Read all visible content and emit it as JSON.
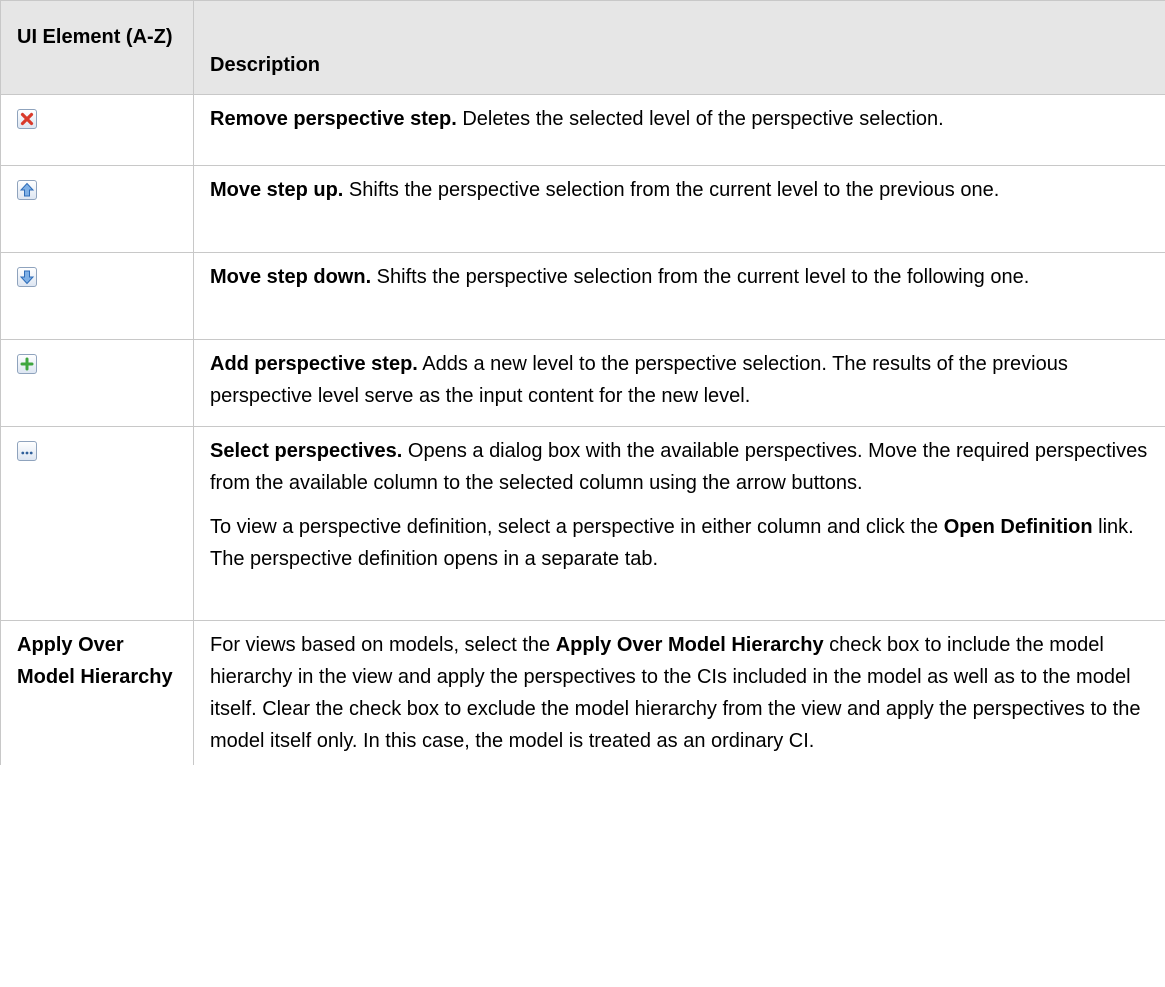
{
  "header": {
    "col1": "UI Element (A-Z)",
    "col2": "Description"
  },
  "rows": [
    {
      "icon": "remove-icon",
      "term": "Remove perspective step.",
      "text": " Deletes the selected level of the perspective selection."
    },
    {
      "icon": "move-up-icon",
      "term": "Move step up.",
      "text": " Shifts the perspective selection from the current level to the previous one."
    },
    {
      "icon": "move-down-icon",
      "term": "Move step down.",
      "text": " Shifts the perspective selection from the current level to the following one."
    },
    {
      "icon": "add-icon",
      "term": "Add perspective step.",
      "text": " Adds a new level to the perspective selection. The results of the previous perspective level serve as the input content for the new level."
    },
    {
      "icon": "ellipsis-icon",
      "term": "Select perspectives.",
      "text": " Opens a dialog box with the available perspectives. Move the required perspectives from the available column to the selected column using the arrow buttons.",
      "p2_a": "To view a perspective definition, select a perspective in either column and click the ",
      "p2_term": "Open Definition",
      "p2_b": " link. The perspective definition opens in a separate tab."
    },
    {
      "ui": "Apply Over Model Hierarchy",
      "a": "For views based on models, select the ",
      "term": "Apply Over Model Hierarchy",
      "b": " check box to include the model hierarchy in the view and apply the perspectives to the CIs included in the model as well as to the model itself. Clear the check box to exclude the model hierarchy from the view and apply the perspectives to the model itself only. In this case, the model is treated as an ordinary CI."
    }
  ]
}
